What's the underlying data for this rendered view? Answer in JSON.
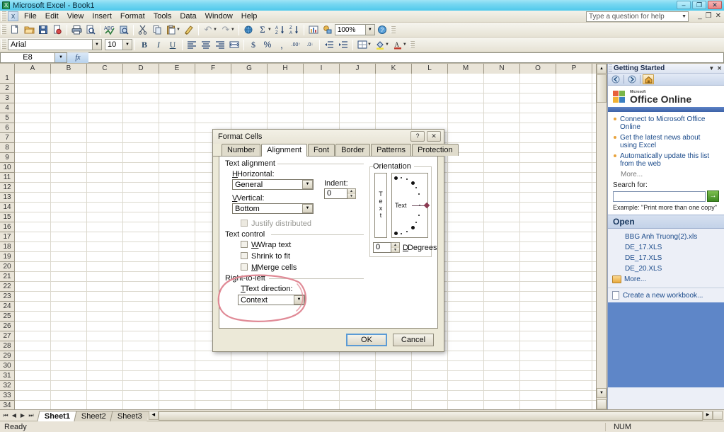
{
  "window": {
    "title": "Microsoft Excel - Book1",
    "app_icon": "excel-icon",
    "minimize": "–",
    "maximize": "❐",
    "close": "✕"
  },
  "menubar": {
    "items": [
      "File",
      "Edit",
      "View",
      "Insert",
      "Format",
      "Tools",
      "Data",
      "Window",
      "Help"
    ],
    "help_placeholder": "Type a question for help",
    "doc_minimize": "_",
    "doc_restore": "❐",
    "doc_close": "✕"
  },
  "standard_toolbar": {
    "buttons": [
      {
        "name": "new-icon",
        "glyph": "🗋"
      },
      {
        "name": "open-icon",
        "glyph": "📂"
      },
      {
        "name": "save-icon",
        "glyph": "💾"
      },
      {
        "name": "permission-icon",
        "glyph": "🗎"
      },
      {
        "name": "print-icon",
        "glyph": "🖨"
      },
      {
        "name": "print-preview-icon",
        "glyph": "🔍"
      },
      {
        "name": "spelling-icon",
        "glyph": "ABC"
      },
      {
        "name": "research-icon",
        "glyph": "📔"
      },
      {
        "name": "cut-icon",
        "glyph": "✂"
      },
      {
        "name": "copy-icon",
        "glyph": "⧉"
      },
      {
        "name": "paste-icon",
        "glyph": "📋"
      },
      {
        "name": "format-painter-icon",
        "glyph": "🖌"
      },
      {
        "name": "undo-icon",
        "glyph": "↶"
      },
      {
        "name": "redo-icon",
        "glyph": "↷"
      },
      {
        "name": "hyperlink-icon",
        "glyph": "🌐"
      },
      {
        "name": "autosum-icon",
        "glyph": "Σ"
      },
      {
        "name": "sort-ascending-icon",
        "glyph": "A↓"
      },
      {
        "name": "sort-descending-icon",
        "glyph": "Z↓"
      },
      {
        "name": "chart-wizard-icon",
        "glyph": "📊"
      },
      {
        "name": "drawing-icon",
        "glyph": "✏"
      }
    ],
    "zoom_value": "100%",
    "help_icon": "?"
  },
  "formatting_toolbar": {
    "font_name": "Arial",
    "font_size": "10",
    "bold": "B",
    "italic": "I",
    "underline": "U",
    "align_left": "≡",
    "align_center": "≡",
    "align_right": "≡",
    "merge_center": "⊞",
    "currency": "$",
    "percent": "%",
    "comma": ",",
    "increase_decimal": ".00",
    "decrease_decimal": ".0",
    "decrease_indent": "⇤",
    "increase_indent": "⇥",
    "borders": "⊞",
    "fill_color": "A",
    "font_color": "A"
  },
  "formula_bar": {
    "name_box": "E8",
    "fx_label": "fx",
    "formula_value": ""
  },
  "sheet": {
    "columns": [
      "A",
      "B",
      "C",
      "D",
      "E",
      "F",
      "G",
      "H",
      "I",
      "J",
      "K",
      "L",
      "M",
      "N",
      "O",
      "P"
    ],
    "row_count": 35,
    "first_row": 1
  },
  "sheet_tabs": {
    "nav": [
      "⏮",
      "◀",
      "▶",
      "⏭"
    ],
    "tabs": [
      {
        "label": "Sheet1",
        "active": true
      },
      {
        "label": "Sheet2",
        "active": false
      },
      {
        "label": "Sheet3",
        "active": false
      }
    ]
  },
  "status_bar": {
    "message": "Ready",
    "num_lock": "NUM"
  },
  "task_pane": {
    "title": "Getting Started",
    "dropdown_icon": "▼",
    "close_icon": "✕",
    "nav": {
      "back_icon": "◀",
      "forward_icon": "▶",
      "home_icon": "🏠"
    },
    "logo_ms": "Microsoft",
    "logo_text": "Office Online",
    "links": [
      "Connect to Microsoft Office Online",
      "Get the latest news about using Excel",
      "Automatically update this list from the web"
    ],
    "more_label": "More...",
    "search_label": "Search for:",
    "search_value": "",
    "go_icon": "→",
    "example_text": "Example: \"Print more than one copy\"",
    "open_header": "Open",
    "files": [
      "BBG Anh Truong(2).xls",
      "DE_17.XLS",
      "DE_17.XLS",
      "DE_20.XLS"
    ],
    "open_more_label": "More...",
    "create_new_label": "Create a new workbook..."
  },
  "dialog": {
    "title": "Format Cells",
    "help_icon": "?",
    "close_icon": "✕",
    "tabs": [
      {
        "label": "Number",
        "active": false
      },
      {
        "label": "Alignment",
        "active": true
      },
      {
        "label": "Font",
        "active": false
      },
      {
        "label": "Border",
        "active": false
      },
      {
        "label": "Patterns",
        "active": false
      },
      {
        "label": "Protection",
        "active": false
      }
    ],
    "text_alignment": {
      "group_label": "Text alignment",
      "horizontal_label": "Horizontal:",
      "horizontal_value": "General",
      "vertical_label": "Vertical:",
      "vertical_value": "Bottom",
      "indent_label": "Indent:",
      "indent_value": "0",
      "justify_distributed_label": "Justify distributed",
      "justify_distributed_checked": false
    },
    "text_control": {
      "group_label": "Text control",
      "wrap_text_label": "Wrap text",
      "wrap_text_checked": false,
      "shrink_to_fit_label": "Shrink to fit",
      "shrink_to_fit_checked": false,
      "merge_cells_label": "Merge cells",
      "merge_cells_checked": false
    },
    "right_to_left": {
      "group_label": "Right-to-left",
      "text_direction_label": "Text direction:",
      "text_direction_value": "Context"
    },
    "orientation": {
      "group_label": "Orientation",
      "vertical_text": "Text",
      "sample_text": "Text",
      "degrees_value": "0",
      "degrees_label": "Degrees"
    },
    "ok_label": "OK",
    "cancel_label": "Cancel"
  },
  "annotation": {
    "shape": "hand-drawn-ellipse",
    "color": "#e08a96",
    "target": "right-to-left-text-direction"
  }
}
